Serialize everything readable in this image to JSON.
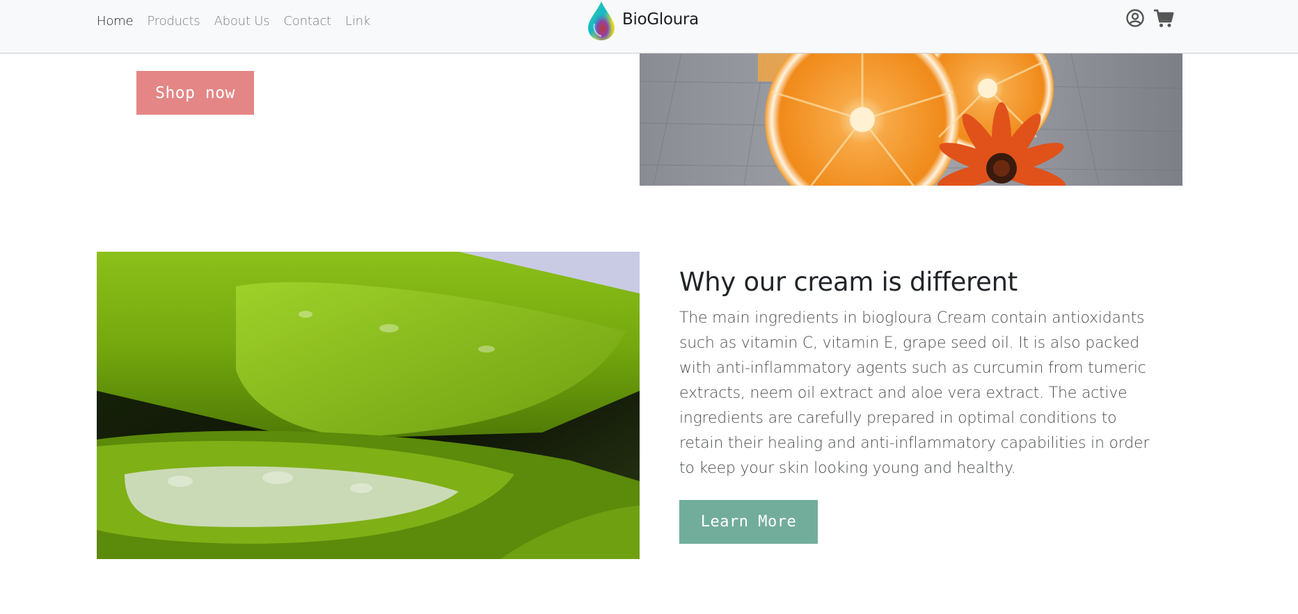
{
  "navbar": {
    "links": [
      {
        "label": "Home",
        "active": true
      },
      {
        "label": "Products"
      },
      {
        "label": "About Us"
      },
      {
        "label": "Contact"
      },
      {
        "label": "Link"
      }
    ],
    "brand_name": "BioGloura",
    "icons": [
      "user-circle-icon",
      "shopping-cart-icon"
    ]
  },
  "hero": {
    "shop_label": "Shop now"
  },
  "feature": {
    "title": "Why our cream is different",
    "body": "The main ingredients in biogloura Cream contain antioxidants such as vitamin C, vitamin E, grape seed oil. It is also packed with anti-inflammatory agents such as curcumin from tumeric extracts, neem oil extract and aloe vera extract. The active ingredients are carefully prepared in optimal conditions to retain their healing and anti-inflammatory capabilities in order to keep your skin looking young and healthy.",
    "button_label": "Learn More"
  },
  "colors": {
    "navbar_bg": "#f8f9fa",
    "shop_button": "#e48686",
    "learn_button": "#72ad9b"
  }
}
